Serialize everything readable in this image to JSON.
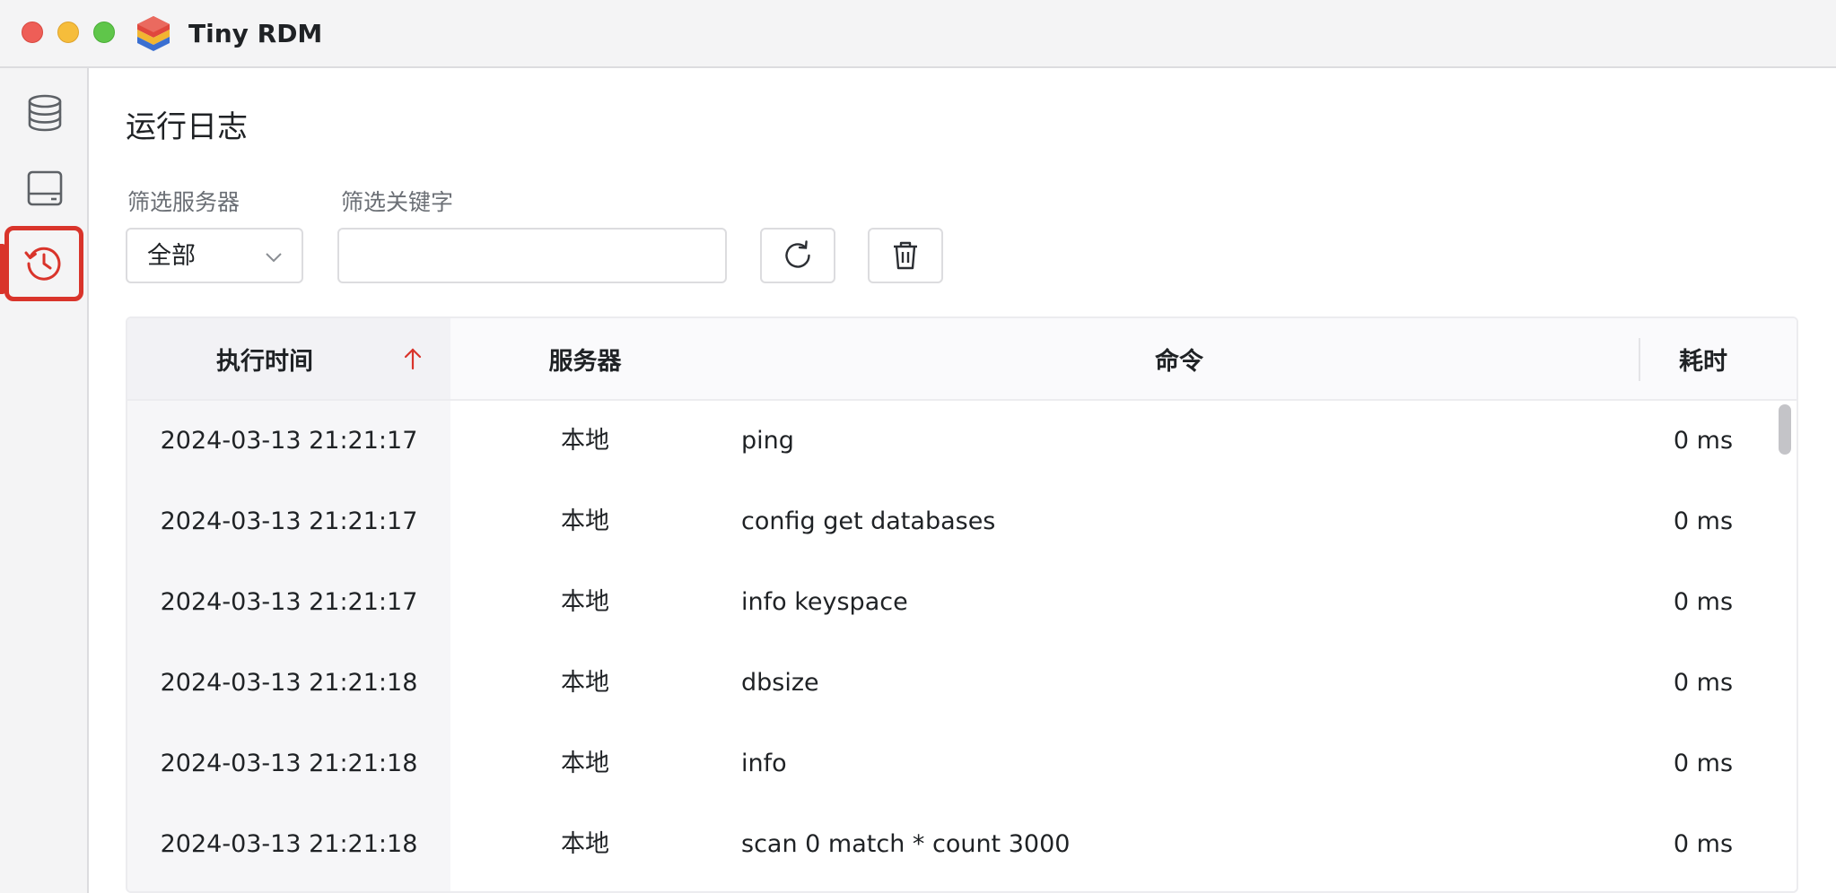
{
  "app": {
    "title": "Tiny RDM"
  },
  "sidebar": {
    "items": [
      {
        "name": "database-icon",
        "active": false
      },
      {
        "name": "terminal-icon",
        "active": false
      },
      {
        "name": "history-icon",
        "active": true
      }
    ]
  },
  "page": {
    "title": "运行日志"
  },
  "filters": {
    "server_label": "筛选服务器",
    "server_value": "全部",
    "keyword_label": "筛选关键字",
    "keyword_value": "",
    "keyword_placeholder": ""
  },
  "toolbar": {
    "refresh_icon": "refresh-icon",
    "delete_icon": "trash-icon"
  },
  "table": {
    "columns": {
      "time": "执行时间",
      "server": "服务器",
      "command": "命令",
      "duration": "耗时"
    },
    "sort": {
      "column": "time",
      "direction": "ascending"
    },
    "rows": [
      {
        "time": "2024-03-13 21:21:17",
        "server": "本地",
        "command": "ping",
        "duration": "0 ms"
      },
      {
        "time": "2024-03-13 21:21:17",
        "server": "本地",
        "command": "config get databases",
        "duration": "0 ms"
      },
      {
        "time": "2024-03-13 21:21:17",
        "server": "本地",
        "command": "info keyspace",
        "duration": "0 ms"
      },
      {
        "time": "2024-03-13 21:21:18",
        "server": "本地",
        "command": "dbsize",
        "duration": "0 ms"
      },
      {
        "time": "2024-03-13 21:21:18",
        "server": "本地",
        "command": "info",
        "duration": "0 ms"
      },
      {
        "time": "2024-03-13 21:21:18",
        "server": "本地",
        "command": "scan 0 match * count 3000",
        "duration": "0 ms"
      }
    ]
  },
  "colors": {
    "accent": "#d9342b",
    "sort_arrow": "#d9342b"
  }
}
